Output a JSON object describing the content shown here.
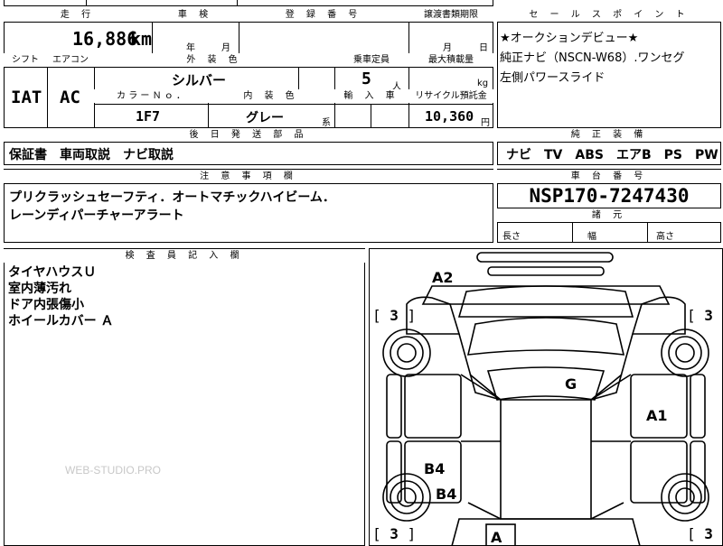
{
  "top_row": [
    "",
    "",
    "",
    ""
  ],
  "mileage": {
    "label": "走 行",
    "value": "16,886",
    "unit": "km"
  },
  "inspection": {
    "label": "車 検",
    "year": "年",
    "month": "月"
  },
  "registration": {
    "label": "登 録 番 号",
    "value": ""
  },
  "transfer_deadline": {
    "label": "譲渡書類期限",
    "month": "月",
    "day": "日"
  },
  "selling_points": {
    "label": "セ ー ル ス ポ イ ン ト",
    "lines": [
      "★オークションデビュー★",
      "純正ナビ（NSCN-W68）.ワンセグ",
      "左側パワースライド"
    ]
  },
  "shift": {
    "label": "シフト",
    "value": "IAT"
  },
  "aircon": {
    "label": "エアコン",
    "value": "AC"
  },
  "exterior_color": {
    "label": "外 装 色",
    "value": "シルバー"
  },
  "capacity": {
    "label": "乗車定員",
    "value": "5",
    "unit": "人"
  },
  "max_load": {
    "label": "最大積載量",
    "value": "",
    "unit": "kg"
  },
  "color_no": {
    "label": "カ ラ ー Ｎ ｏ ．",
    "value": "1F7"
  },
  "interior_color": {
    "label": "内 装 色",
    "value": "グレー",
    "suffix": "系"
  },
  "import": {
    "label": "輸 入 車",
    "value": ""
  },
  "recycle": {
    "label": "リサイクル預託金",
    "value": "10,360",
    "unit": "円"
  },
  "later_parts": {
    "label": "後 日 発 送 部 品",
    "value": "保証書　車両取説　ナビ取説"
  },
  "factory_equipment": {
    "label": "純 正 装 備",
    "value": "ナビ　TV　ABS　エアB　PS　PW"
  },
  "notes": {
    "label": "注 意 事 項 欄",
    "lines": [
      "プリクラッシュセーフティ．オートマチックハイビーム．",
      "レーンディパーチャーアラート"
    ]
  },
  "chassis": {
    "label": "車 台 番 号",
    "value": "NSP170-7247430"
  },
  "dimensions": {
    "label": "諸 元",
    "length": "長さ",
    "width": "幅",
    "height": "高さ"
  },
  "inspector": {
    "label": "検 査 員 記 入 欄",
    "lines": [
      "タイヤハウスＵ",
      "室内薄汚れ",
      "ドア内張傷小",
      "ホイールカバー Ａ"
    ]
  },
  "diagram_marks": {
    "a2": "A2",
    "g": "G",
    "a1": "A1",
    "b4_a": "B4",
    "b4_b": "B4",
    "a_bottom": "A",
    "tire": "3",
    "bracket_open": "[",
    "bracket_close": "]"
  },
  "watermark": "WEB-STUDIO.PRO"
}
